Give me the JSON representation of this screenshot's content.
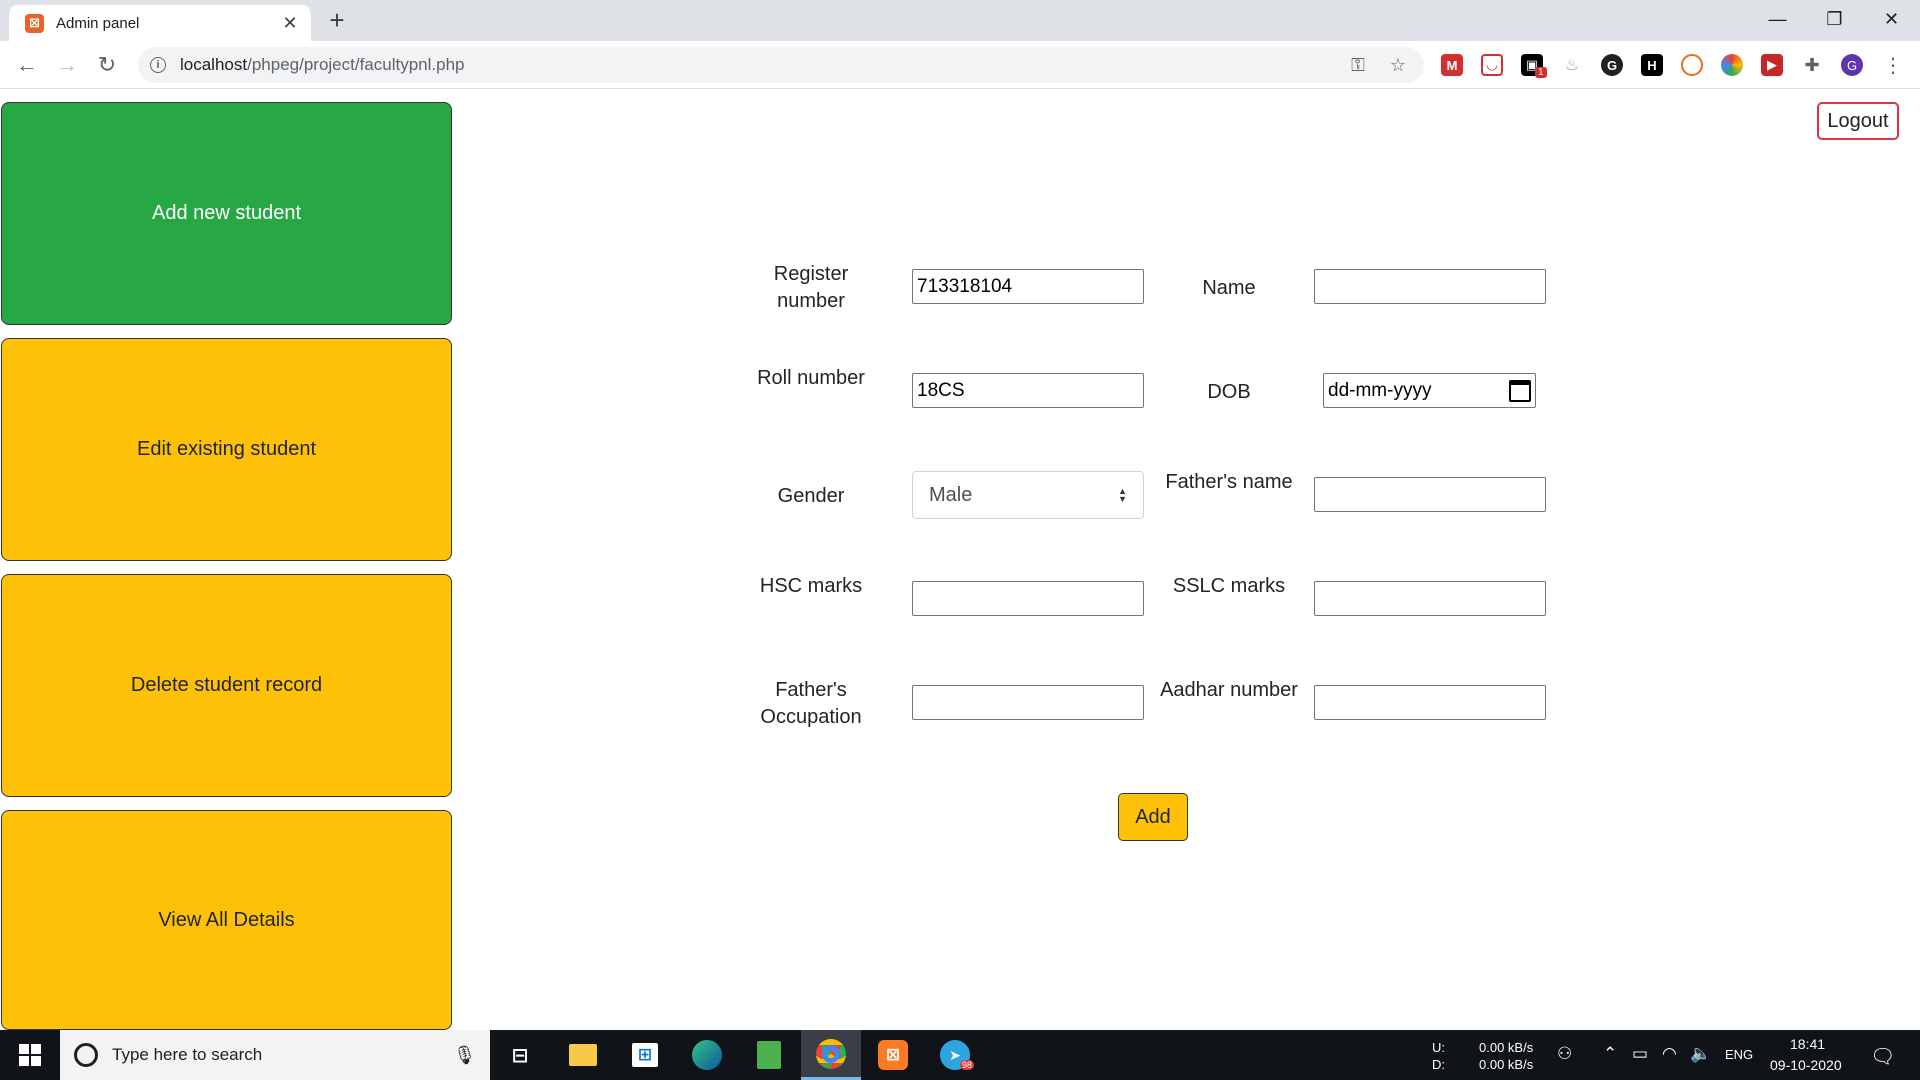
{
  "browser": {
    "tab_title": "Admin panel",
    "tab_favicon": "xampp-icon",
    "url_host": "localhost",
    "url_path": "/phpeg/project/facultypnl.php",
    "profile_initial": "G",
    "ext_badge": "1"
  },
  "sidebar": {
    "items": [
      {
        "label": "Add new student",
        "color": "#28a745"
      },
      {
        "label": "Edit existing student",
        "color": "#ffc107"
      },
      {
        "label": "Delete student record",
        "color": "#ffc107"
      },
      {
        "label": "View All Details",
        "color": "#ffc107"
      }
    ]
  },
  "header": {
    "logout_label": "Logout"
  },
  "form": {
    "register_number_label": "Register number",
    "register_number_value": "713318104",
    "name_label": "Name",
    "name_value": "",
    "roll_number_label": "Roll number",
    "roll_number_value": "18CS",
    "dob_label": "DOB",
    "dob_placeholder": "dd-mm-yyyy",
    "gender_label": "Gender",
    "gender_value": "Male",
    "fathers_name_label": "Father's name",
    "fathers_name_value": "",
    "hsc_label": "HSC marks",
    "hsc_value": "",
    "sslc_label": "SSLC marks",
    "sslc_value": "",
    "fathers_occupation_label": "Father's Occupation",
    "fathers_occupation_value": "",
    "aadhar_label": "Aadhar number",
    "aadhar_value": "",
    "add_label": "Add"
  },
  "taskbar": {
    "search_placeholder": "Type here to search",
    "net_up_label": "U:",
    "net_down_label": "D:",
    "net_up_value": "0.00 kB/s",
    "net_down_value": "0.00 kB/s",
    "language": "ENG",
    "time": "18:41",
    "date": "09-10-2020",
    "telegram_badge": "98"
  },
  "colors": {
    "accent_green": "#28a745",
    "accent_yellow": "#ffc107",
    "logout_border": "#dc3545"
  }
}
